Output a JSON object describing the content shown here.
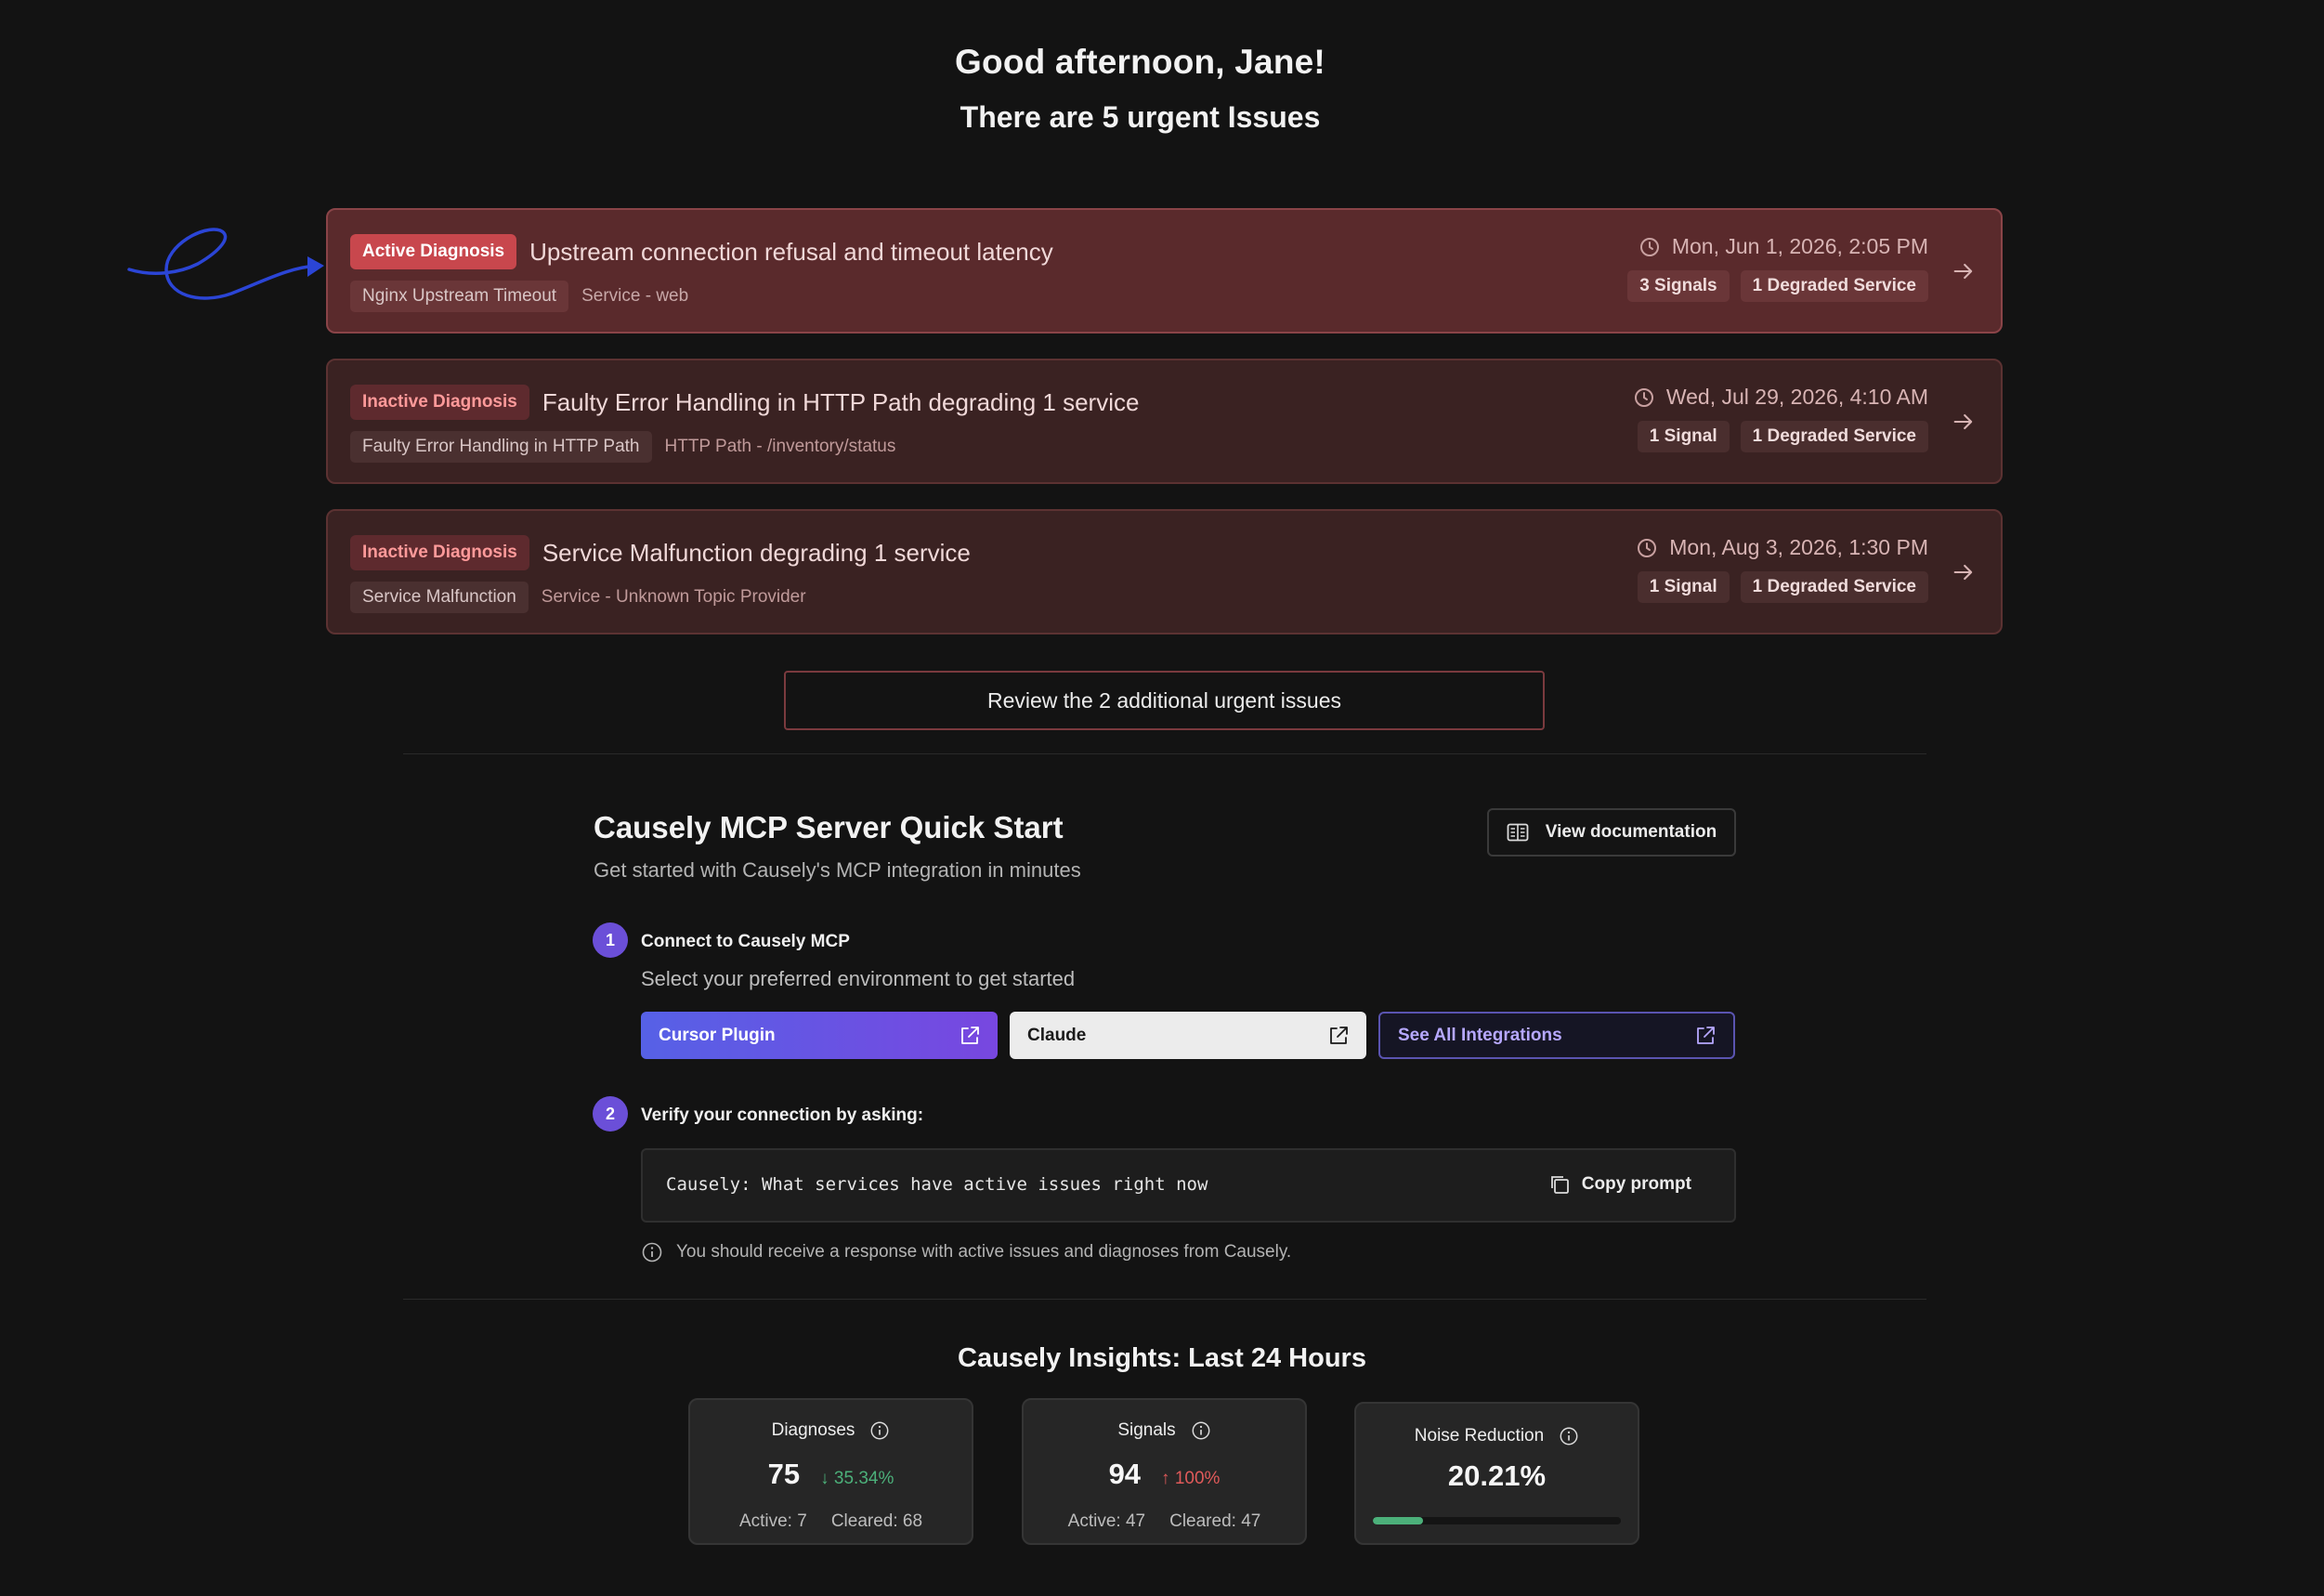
{
  "header": {
    "greeting": "Good afternoon, Jane!",
    "subtitle": "There are 5 urgent Issues"
  },
  "issues": [
    {
      "status": "Active Diagnosis",
      "title": "Upstream connection refusal and timeout latency",
      "tag": "Nginx Upstream Timeout",
      "entity": "Service - web",
      "date": "Mon, Jun 1, 2026, 2:05 PM",
      "signals": "3 Signals",
      "degraded": "1 Degraded Service"
    },
    {
      "status": "Inactive Diagnosis",
      "title": "Faulty Error Handling in HTTP Path degrading 1 service",
      "tag": "Faulty Error Handling in HTTP Path",
      "entity": "HTTP Path - /inventory/status",
      "date": "Wed, Jul 29, 2026, 4:10 AM",
      "signals": "1 Signal",
      "degraded": "1 Degraded Service"
    },
    {
      "status": "Inactive Diagnosis",
      "title": "Service Malfunction degrading 1 service",
      "tag": "Service Malfunction",
      "entity": "Service - Unknown Topic Provider",
      "date": "Mon, Aug 3, 2026, 1:30 PM",
      "signals": "1 Signal",
      "degraded": "1 Degraded Service"
    }
  ],
  "review_button": "Review the 2 additional urgent issues",
  "quickstart": {
    "title": "Causely MCP Server Quick Start",
    "subtitle": "Get started with Causely's MCP integration in minutes",
    "docs_button": "View documentation",
    "step1": {
      "number": "1",
      "title": "Connect to Causely MCP",
      "desc": "Select your preferred environment to get started",
      "buttons": [
        "Cursor Plugin",
        "Claude",
        "See All Integrations"
      ]
    },
    "step2": {
      "number": "2",
      "title": "Verify your connection by asking:",
      "prompt": "Causely: What services have active issues right now",
      "copy_label": "Copy prompt",
      "hint": "You should receive a response with active issues and diagnoses from Causely."
    }
  },
  "insights": {
    "title": "Causely Insights: Last 24 Hours",
    "cards": [
      {
        "label": "Diagnoses",
        "value": "75",
        "trend": "↓ 35.34%",
        "active": "Active: 7",
        "cleared": "Cleared: 68"
      },
      {
        "label": "Signals",
        "value": "94",
        "trend": "↑ 100%",
        "active": "Active: 47",
        "cleared": "Cleared: 47"
      },
      {
        "label": "Noise Reduction",
        "value": "20.21%",
        "progress": 0.2021
      }
    ]
  },
  "colors": {
    "accent_purple": "#6b4fd8",
    "active_badge": "#c8474d",
    "trend_down": "#4cb07a",
    "trend_up": "#e05a5a"
  }
}
